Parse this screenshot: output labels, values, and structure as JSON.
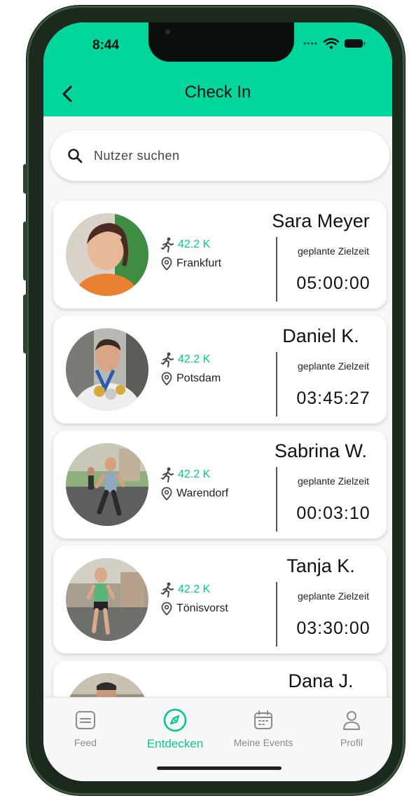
{
  "status_bar": {
    "time": "8:44"
  },
  "header": {
    "title": "Check In"
  },
  "search": {
    "placeholder": "Nutzer suchen",
    "value": ""
  },
  "time_label": "geplante Zielzeit",
  "checkins": [
    {
      "name": "Sara Meyer",
      "distance": "42.2 K",
      "location": "Frankfurt",
      "planned_time": "05:00:00"
    },
    {
      "name": "Daniel K.",
      "distance": "42.2 K",
      "location": "Potsdam",
      "planned_time": "03:45:27"
    },
    {
      "name": "Sabrina W.",
      "distance": "42.2 K",
      "location": "Warendorf",
      "planned_time": "00:03:10"
    },
    {
      "name": "Tanja K.",
      "distance": "42.2 K",
      "location": "Tönisvorst",
      "planned_time": "03:30:00"
    },
    {
      "name": "Dana J.",
      "distance": "",
      "location": "",
      "planned_time": ""
    }
  ],
  "nav": {
    "items": [
      {
        "label": "Feed",
        "icon": "feed-icon",
        "active": false
      },
      {
        "label": "Entdecken",
        "icon": "compass-icon",
        "active": true
      },
      {
        "label": "Meine Events",
        "icon": "calendar-icon",
        "active": false
      },
      {
        "label": "Profil",
        "icon": "profile-icon",
        "active": false
      }
    ]
  },
  "colors": {
    "accent": "#03d69c",
    "accent_text": "#03c892",
    "background": "#f7f7f7"
  }
}
